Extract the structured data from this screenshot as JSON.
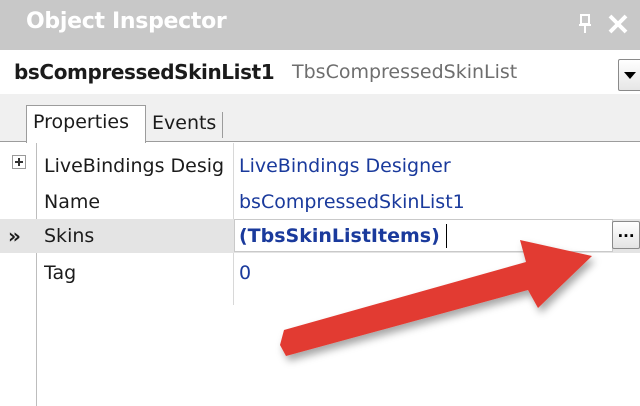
{
  "window": {
    "title": "Object Inspector"
  },
  "object_selector": {
    "name": "bsCompressedSkinList1",
    "type": "TbsCompressedSkinList"
  },
  "tabs": [
    {
      "label": "Properties",
      "active": true
    },
    {
      "label": "Events",
      "active": false
    }
  ],
  "properties": [
    {
      "name": "LiveBindings Desig",
      "value": "LiveBindings Designer",
      "expandable": true
    },
    {
      "name": "Name",
      "value": "bsCompressedSkinList1"
    },
    {
      "name": "Skins",
      "value": "(TbsSkinListItems)",
      "selected": true,
      "marker": "»"
    },
    {
      "name": "Tag",
      "value": "0"
    }
  ],
  "ellipsis_button": {
    "label": "..."
  },
  "colors": {
    "titlebar": "#c8c8c8",
    "value_text": "#1a3a9c",
    "arrow": "#e23b32",
    "selected_row": "#e4e4e4"
  }
}
